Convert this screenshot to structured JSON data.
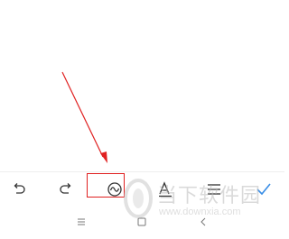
{
  "toolbar": {
    "buttons": [
      {
        "id": "undo",
        "icon": "undo-icon"
      },
      {
        "id": "redo",
        "icon": "redo-icon"
      },
      {
        "id": "doodle",
        "icon": "doodle-squiggle-icon",
        "highlighted": true
      },
      {
        "id": "text-style",
        "icon": "text-format-icon"
      },
      {
        "id": "list",
        "icon": "list-icon"
      },
      {
        "id": "confirm",
        "icon": "checkmark-icon"
      }
    ],
    "highlight_color": "#e02020",
    "accent_color": "#3a8ee6"
  },
  "navbar": {
    "buttons": [
      {
        "id": "menu",
        "icon": "menu-icon"
      },
      {
        "id": "home",
        "icon": "home-square-icon"
      },
      {
        "id": "back",
        "icon": "back-chevron-icon"
      }
    ]
  },
  "watermark": {
    "title": "当下软件园",
    "url": "www.downxia.com"
  },
  "annotation": {
    "arrow_color": "#e02020"
  }
}
